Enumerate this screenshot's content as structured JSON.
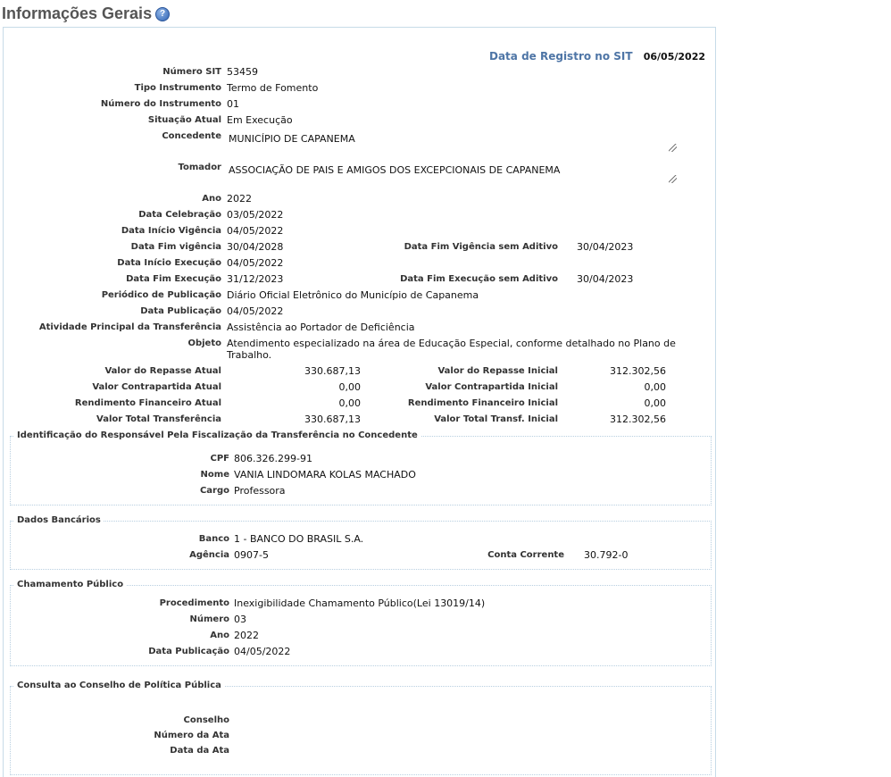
{
  "page": {
    "title": "Informações Gerais",
    "help_icon": "question-icon"
  },
  "registro": {
    "label": "Data de Registro no SIT",
    "value": "06/05/2022"
  },
  "geral": {
    "numero_sit": {
      "label": "Número SIT",
      "value": "53459"
    },
    "tipo_instrumento": {
      "label": "Tipo Instrumento",
      "value": "Termo de Fomento"
    },
    "numero_instrumento": {
      "label": "Número do Instrumento",
      "value": "01"
    },
    "situacao_atual": {
      "label": "Situação Atual",
      "value": "Em Execução"
    },
    "concedente": {
      "label": "Concedente",
      "value": "MUNICÍPIO DE CAPANEMA"
    },
    "tomador": {
      "label": "Tomador",
      "value": "ASSOCIAÇÃO DE PAIS E AMIGOS DOS EXCEPCIONAIS DE CAPANEMA"
    },
    "ano": {
      "label": "Ano",
      "value": "2022"
    },
    "data_celebracao": {
      "label": "Data Celebração",
      "value": "03/05/2022"
    },
    "data_inicio_vigencia": {
      "label": "Data Início Vigência",
      "value": "04/05/2022"
    },
    "data_fim_vigencia": {
      "label": "Data Fim vigência",
      "value": "30/04/2028"
    },
    "data_fim_vigencia_sem_aditivo": {
      "label": "Data Fim Vigência sem Aditivo",
      "value": "30/04/2023"
    },
    "data_inicio_execucao": {
      "label": "Data Início Execução",
      "value": "04/05/2022"
    },
    "data_fim_execucao": {
      "label": "Data Fim Execução",
      "value": "31/12/2023"
    },
    "data_fim_execucao_sem_aditivo": {
      "label": "Data Fim Execução sem Aditivo",
      "value": "30/04/2023"
    },
    "periodico_publicacao": {
      "label": "Periódico de Publicação",
      "value": "Diário Oficial Eletrônico do Município de Capanema"
    },
    "data_publicacao": {
      "label": "Data Publicação",
      "value": "04/05/2022"
    },
    "atividade_principal": {
      "label": "Atividade Principal da Transferência",
      "value": "Assistência ao Portador de Deficiência"
    },
    "objeto": {
      "label": "Objeto",
      "line1": "Atendimento especializado na área de Educação Especial, conforme detalhado no Plano de",
      "line2": "Trabalho."
    },
    "valor_repasse_atual": {
      "label": "Valor do Repasse Atual",
      "value": "330.687,13"
    },
    "valor_repasse_inicial": {
      "label": "Valor do Repasse Inicial",
      "value": "312.302,56"
    },
    "valor_contrapartida_atual": {
      "label": "Valor Contrapartida Atual",
      "value": "0,00"
    },
    "valor_contrapartida_inicial": {
      "label": "Valor Contrapartida Inicial",
      "value": "0,00"
    },
    "rendimento_atual": {
      "label": "Rendimento Financeiro Atual",
      "value": "0,00"
    },
    "rendimento_inicial": {
      "label": "Rendimento Financeiro Inicial",
      "value": "0,00"
    },
    "valor_total": {
      "label": "Valor Total Transferência",
      "value": "330.687,13"
    },
    "valor_total_inicial": {
      "label": "Valor Total Transf. Inicial",
      "value": "312.302,56"
    }
  },
  "responsavel": {
    "legend": "Identificação do Responsável Pela Fiscalização da Transferência no Concedente",
    "cpf": {
      "label": "CPF",
      "value": "806.326.299-91"
    },
    "nome": {
      "label": "Nome",
      "value": "VANIA LINDOMARA KOLAS MACHADO"
    },
    "cargo": {
      "label": "Cargo",
      "value": "Professora"
    }
  },
  "bancarios": {
    "legend": "Dados Bancários",
    "banco": {
      "label": "Banco",
      "value": "1 - BANCO DO BRASIL S.A."
    },
    "agencia": {
      "label": "Agência",
      "value": "0907-5"
    },
    "conta": {
      "label": "Conta Corrente",
      "value": "30.792-0"
    }
  },
  "chamamento": {
    "legend": "Chamamento Público",
    "procedimento": {
      "label": "Procedimento",
      "value": "Inexigibilidade Chamamento Público(Lei 13019/14)"
    },
    "numero": {
      "label": "Número",
      "value": "03"
    },
    "ano": {
      "label": "Ano",
      "value": "2022"
    },
    "data_publicacao": {
      "label": "Data Publicação",
      "value": "04/05/2022"
    }
  },
  "conselho": {
    "legend": "Consulta ao Conselho de Política Pública",
    "conselho_label": "Conselho",
    "numero_ata_label": "Número da Ata",
    "data_ata_label": "Data da Ata"
  }
}
